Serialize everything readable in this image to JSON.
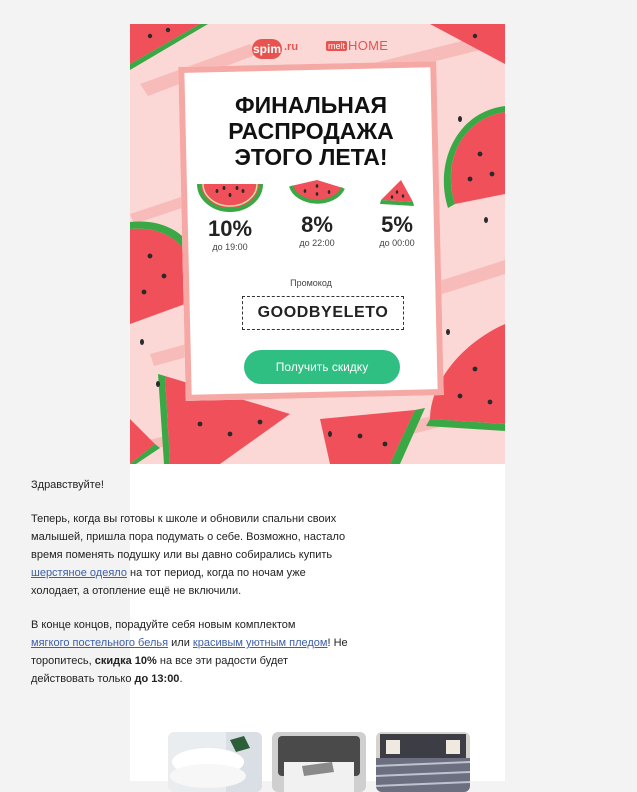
{
  "header": {
    "logo_spim": "spim",
    "logo_spim_suffix": ".ru",
    "logo_home_mark": "melt",
    "logo_home_word": "HOME"
  },
  "hero": {
    "headline_line1": "ФИНАЛЬНАЯ",
    "headline_line2": "РАСПРОДАЖА",
    "headline_line3": "ЭТОГО ЛЕТА!",
    "discounts": [
      {
        "value": "10%",
        "time": "до 19:00"
      },
      {
        "value": "8%",
        "time": "до 22:00"
      },
      {
        "value": "5%",
        "time": "до 00:00"
      }
    ],
    "promo_label": "Промокод",
    "promo_code": "GOODBYELETO",
    "cta_label": "Получить скидку"
  },
  "body": {
    "greeting": "Здравствуйте!",
    "p1_before_link": "Теперь, когда вы готовы к школе и обновили спальни своих малышей, пришла пора подумать о себе. Возможно, настало время поменять подушку или вы давно собирались купить ",
    "p1_link": "шерстяное одеяло",
    "p1_after_link": " на тот период, когда по ночам уже холодает, а отопление ещё не включили.",
    "p2_start": "В конце концов, порадуйте себя новым комплектом ",
    "p2_link1": "мягкого постельного белья",
    "p2_mid": " или ",
    "p2_link2": "красивым уютным пледом",
    "p2_excl": "!",
    "p2_cont": " Не торопитесь, ",
    "p2_bold1": "скидка 10%",
    "p2_cont2": " на все эти радости будет действовать только ",
    "p2_bold2": "до 13:00",
    "p2_end": "."
  },
  "colors": {
    "hero_bg": "#fbd8d6",
    "card_border": "#f5a8a4",
    "cta_bg": "#2fbf82",
    "link": "#3d5fa8",
    "watermelon_flesh": "#f0505a",
    "watermelon_rind": "#3aa845"
  }
}
